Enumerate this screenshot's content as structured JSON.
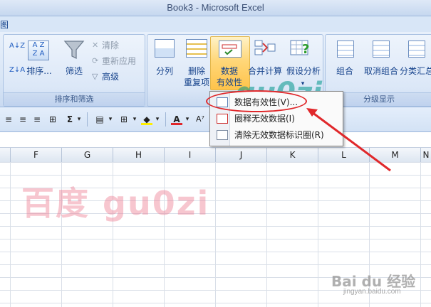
{
  "window": {
    "title": "Book3 - Microsoft Excel"
  },
  "tab_fragment": "图",
  "ribbon": {
    "sort_filter": {
      "label": "排序和筛选",
      "sort": "排序...",
      "filter": "筛选",
      "clear": "清除",
      "reapply": "重新应用",
      "advanced": "高级"
    },
    "data_tools": {
      "split": "分列",
      "remove_dup_line1": "删除",
      "remove_dup_line2": "重复项",
      "validation_line1": "数据",
      "validation_line2": "有效性",
      "consolidate": "合并计算",
      "whatif": "假设分析"
    },
    "outline": {
      "label": "分级显示",
      "group": "组合",
      "ungroup": "取消组合",
      "subtotal": "分类汇总"
    }
  },
  "dropdown": {
    "items": [
      {
        "label": "数据有效性(V)...",
        "icon": "data-validation-icon"
      },
      {
        "label": "圈释无效数据(I)",
        "icon": "circle-invalid-icon"
      },
      {
        "label": "清除无效数据标识圈(R)",
        "icon": "clear-circles-icon"
      }
    ]
  },
  "columns": [
    "F",
    "G",
    "H",
    "I",
    "J",
    "K",
    "L",
    "M",
    "N"
  ],
  "watermarks": {
    "main": "百度  gu0zi",
    "script": "gu0zi",
    "logo": "Bai du 经验",
    "url": "jingyan.baidu.com"
  },
  "colors": {
    "highlight_circle": "#e0282b",
    "arrow": "#e0282b",
    "ribbon_text": "#15428b"
  }
}
